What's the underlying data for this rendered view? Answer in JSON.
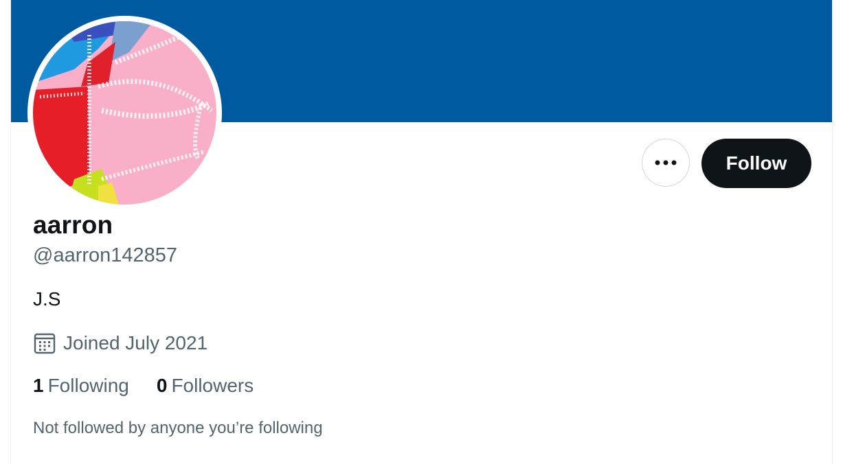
{
  "colors": {
    "banner": "#005aa0",
    "follow_bg": "#0f1419",
    "follow_text": "#ffffff",
    "secondary_text": "#536471",
    "primary_text": "#0f1419"
  },
  "profile": {
    "display_name": "aarron",
    "handle": "@aarron142857",
    "bio": "J.S",
    "joined": "Joined July 2021",
    "joined_icon": "calendar-icon",
    "avatar_icon": "avatar-image"
  },
  "actions": {
    "more_icon": "more-horizontal-icon",
    "follow_label": "Follow"
  },
  "stats": {
    "following_count": "1",
    "following_label": "Following",
    "followers_count": "0",
    "followers_label": "Followers"
  },
  "social_context": "Not followed by anyone you’re following"
}
